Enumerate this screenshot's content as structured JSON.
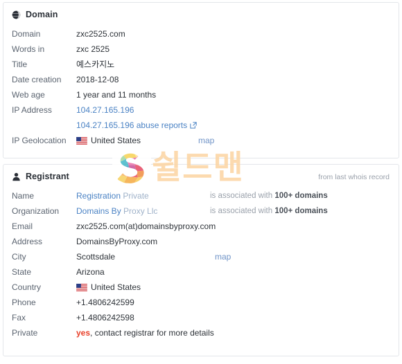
{
  "domain_card": {
    "icon": "globe-icon",
    "title": "Domain",
    "rows": [
      {
        "label": "Domain",
        "value": "zxc2525.com"
      },
      {
        "label": "Words in",
        "value": "zxc 2525"
      },
      {
        "label": "Title",
        "value": "예스카지노"
      },
      {
        "label": "Date creation",
        "value": "2018-12-08"
      },
      {
        "label": "Web age",
        "value": "1 year and 11 months"
      },
      {
        "label": "IP Address",
        "value": "104.27.165.196"
      },
      {
        "label": "",
        "value": "104.27.165.196 abuse reports"
      },
      {
        "label": "IP Geolocation",
        "value": "United States"
      }
    ],
    "ip_address_link": "104.27.165.196",
    "abuse_reports_link": "104.27.165.196 abuse reports",
    "abuse_reports_icon": "external-link-icon",
    "geo_flag": "us-flag-icon",
    "geo_country": "United States",
    "geo_map_link": "map"
  },
  "registrant_card": {
    "icon": "user-icon",
    "title": "Registrant",
    "note": "from last whois record",
    "rows": [
      {
        "label": "Name",
        "value_link": "Registration",
        "value_dim": "Private",
        "extra_prefix": "is associated with ",
        "extra_bold": "100+ domains"
      },
      {
        "label": "Organization",
        "value_link": "Domains By",
        "value_dim": "Proxy Llc",
        "extra_prefix": "is associated with ",
        "extra_bold": "100+ domains"
      },
      {
        "label": "Email",
        "value": "zxc2525.com(at)domainsbyproxy.com"
      },
      {
        "label": "Address",
        "value": "DomainsByProxy.com"
      },
      {
        "label": "City",
        "value": "Scottsdale",
        "map": "map"
      },
      {
        "label": "State",
        "value": "Arizona"
      },
      {
        "label": "Country",
        "value": "United States",
        "flag": "us-flag-icon"
      },
      {
        "label": "Phone",
        "value": "+1.4806242599"
      },
      {
        "label": "Fax",
        "value": "+1.4806242598"
      },
      {
        "label": "Private",
        "value_red": "yes",
        "value_rest": ", contact registrar for more details"
      }
    ]
  },
  "watermark": {
    "logo": "shieldman-s-logo",
    "text": "쉴드맨"
  },
  "colors": {
    "link": "#4a82c4",
    "link_dim": "#9fb2c9",
    "map_link": "#6f93c7",
    "label": "#5b6470",
    "value": "#2d3238",
    "muted": "#9aa1ab",
    "red": "#e8402a",
    "card_border": "#e3e6ea",
    "watermark_text": "#fcd6a4"
  }
}
